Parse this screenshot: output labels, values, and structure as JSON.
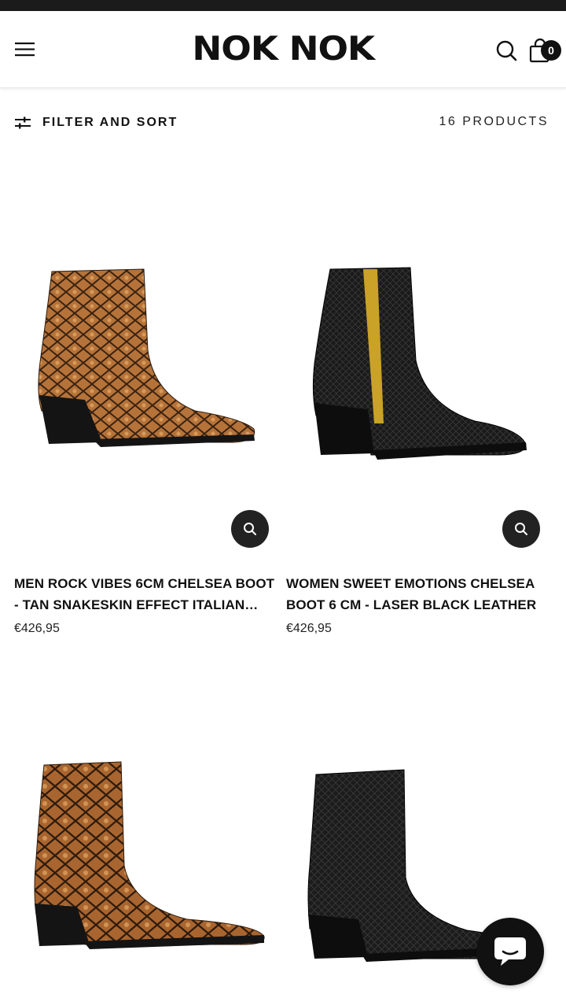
{
  "header": {
    "brand": "NOK NOK",
    "cart_count": "0"
  },
  "toolbar": {
    "filter_label": "FILTER AND SORT",
    "product_count": "16 PRODUCTS"
  },
  "products": [
    {
      "title": "MEN ROCK VIBES 6CM CHELSEA BOOT - TAN SNAKESKIN EFFECT ITALIAN…",
      "price": "€426,95",
      "color": "tan snakeskin"
    },
    {
      "title": "WOMEN SWEET EMOTIONS CHELSEA BOOT 6 CM - LASER BLACK LEATHER",
      "price": "€426,95",
      "color": "black leather"
    },
    {
      "color": "tan snakeskin"
    },
    {
      "color": "black leather"
    }
  ],
  "icons": {
    "menu": "hamburger-icon",
    "search": "search-icon",
    "cart": "shopping-bag-icon",
    "filter": "sliders-icon",
    "quick_view": "magnifier-icon",
    "chat": "chat-bubble-icon"
  },
  "colors": {
    "text": "#111111",
    "tan": "#b06a34",
    "black": "#111111"
  }
}
